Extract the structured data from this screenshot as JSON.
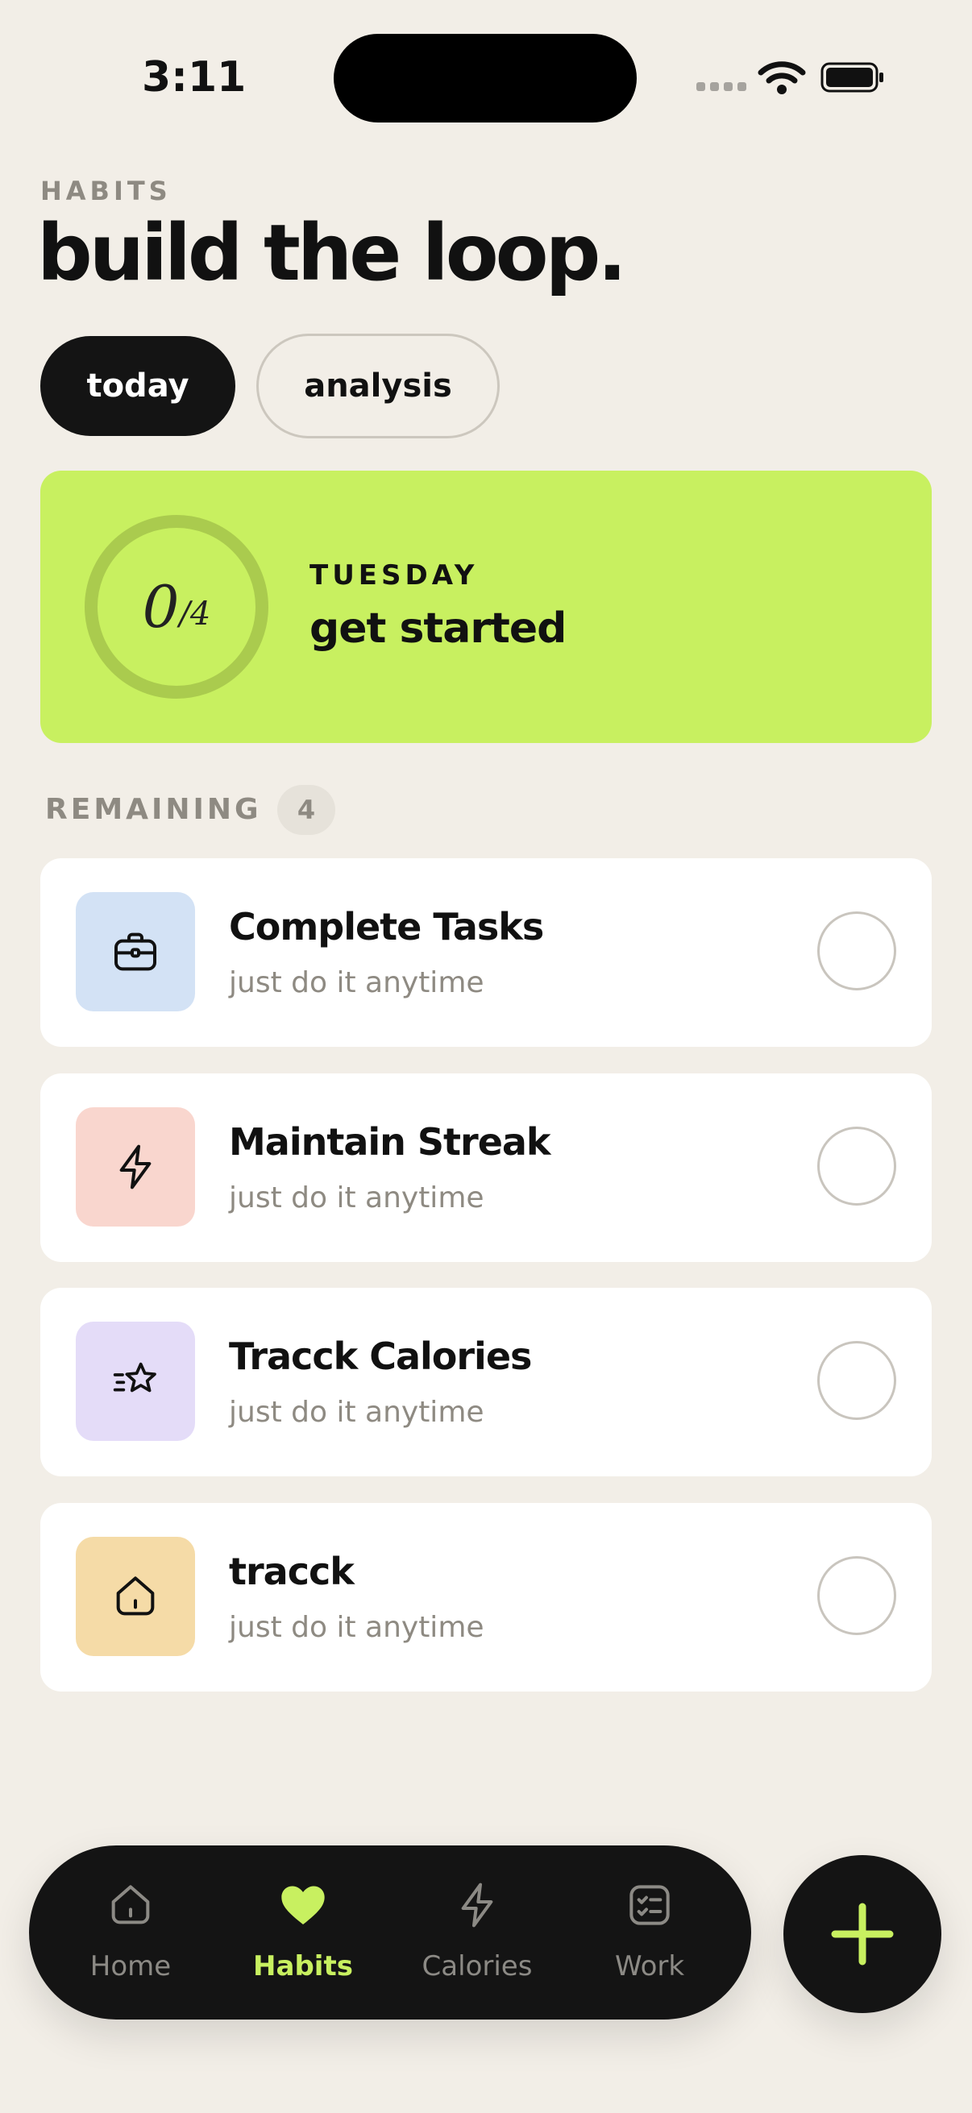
{
  "status_bar": {
    "time": "3:11"
  },
  "header": {
    "eyebrow": "HABITS",
    "title": "build the loop."
  },
  "tabs": [
    {
      "label": "today",
      "active": true
    },
    {
      "label": "analysis",
      "active": false
    }
  ],
  "summary": {
    "completed": "0",
    "total": "/4",
    "progress_fraction": 0,
    "day": "TUESDAY",
    "status": "get started",
    "accent_color": "#C8F060"
  },
  "remaining": {
    "label": "REMAINING",
    "count": "4"
  },
  "habits": [
    {
      "name": "Complete Tasks",
      "subtitle": "just do it anytime",
      "icon": "briefcase-icon",
      "color": "#D3E2F5",
      "done": false
    },
    {
      "name": "Maintain Streak",
      "subtitle": "just do it anytime",
      "icon": "lightning-icon",
      "color": "#F9D6CE",
      "done": false
    },
    {
      "name": "Tracck Calories",
      "subtitle": "just do it anytime",
      "icon": "star-icon",
      "color": "#E4DCF8",
      "done": false
    },
    {
      "name": "tracck",
      "subtitle": "just do it anytime",
      "icon": "home-icon",
      "color": "#F5DBA7",
      "done": false
    }
  ],
  "nav": {
    "items": [
      {
        "label": "Home",
        "icon": "home-icon",
        "active": false
      },
      {
        "label": "Habits",
        "icon": "heart-icon",
        "active": true
      },
      {
        "label": "Calories",
        "icon": "lightning-icon",
        "active": false
      },
      {
        "label": "Work",
        "icon": "checklist-icon",
        "active": false
      }
    ],
    "add_icon": "plus-icon"
  }
}
